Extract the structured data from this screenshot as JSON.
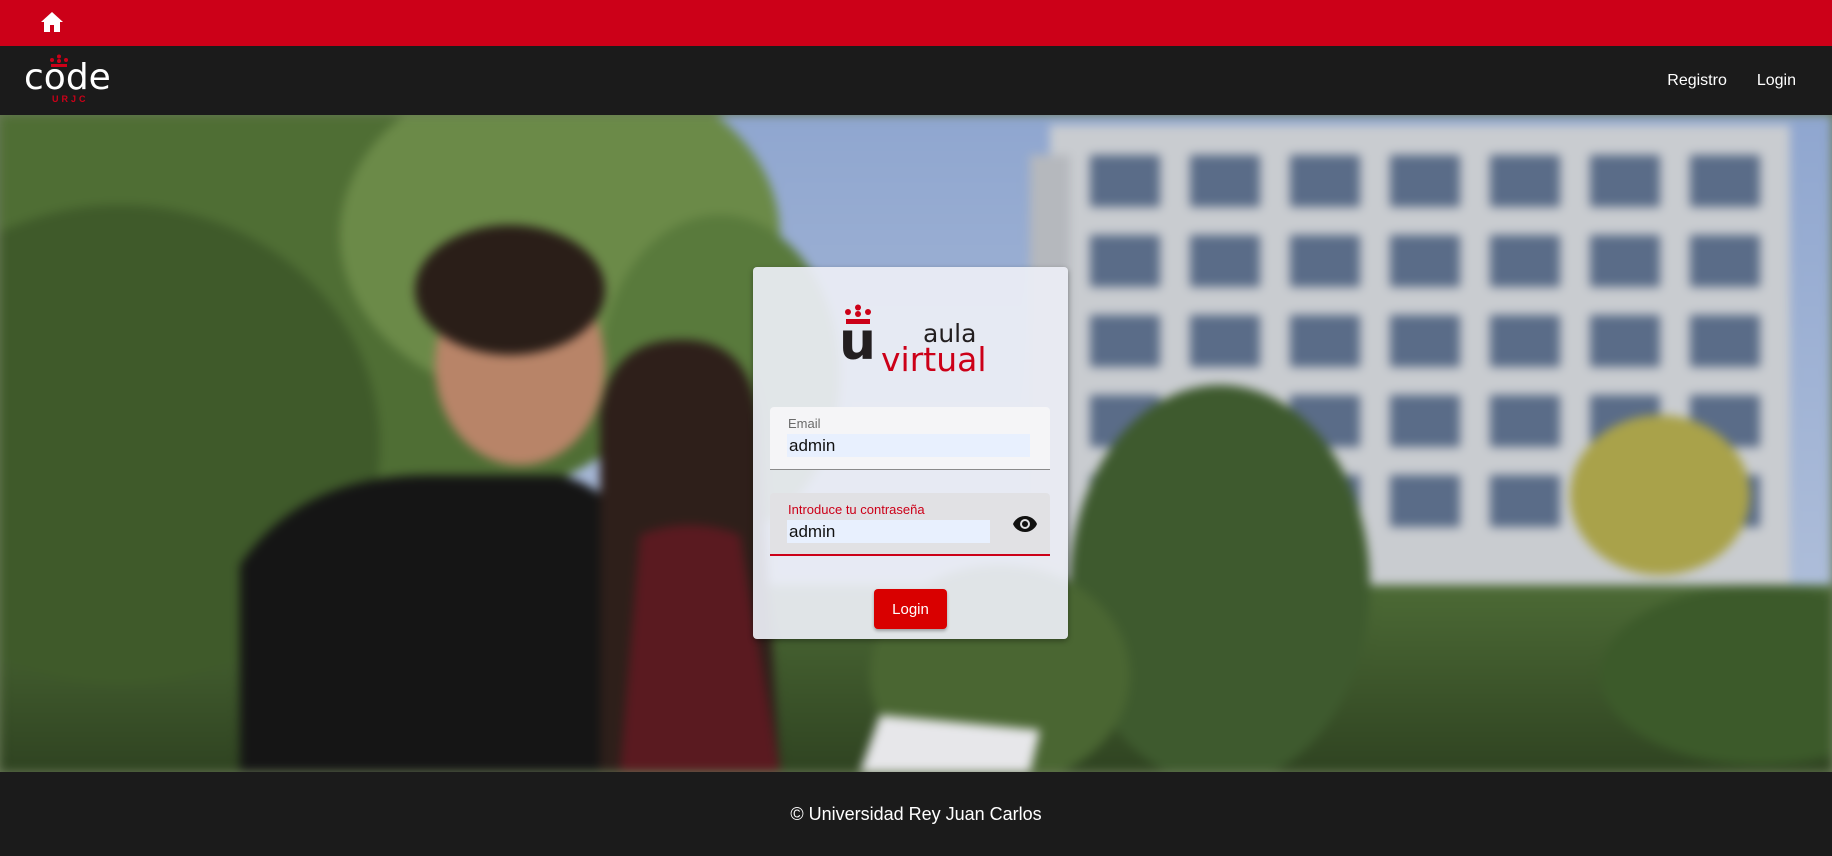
{
  "topbar": {
    "home_icon": "home-icon",
    "color": "#cc0018"
  },
  "navbar": {
    "logo": {
      "word": "code",
      "sub": "URJC"
    },
    "links": [
      {
        "label": "Registro"
      },
      {
        "label": "Login"
      }
    ]
  },
  "login_card": {
    "brand": {
      "letter": "u",
      "word1": "aula",
      "word2": "virtual"
    },
    "email": {
      "label": "Email",
      "value": "admin"
    },
    "password": {
      "label": "Introduce tu contraseña",
      "value": "admin",
      "toggle_icon": "eye-icon"
    },
    "submit_label": "Login",
    "accent": "#cc0018"
  },
  "footer": {
    "text": "© Universidad Rey Juan Carlos"
  }
}
